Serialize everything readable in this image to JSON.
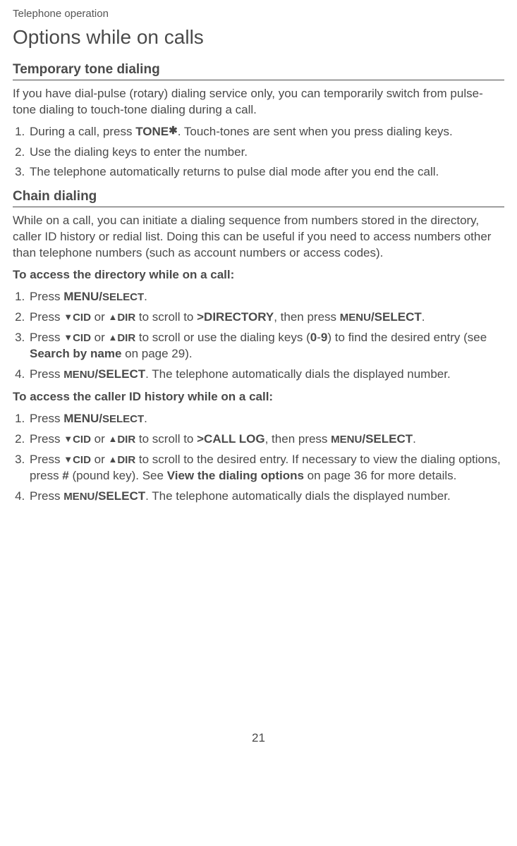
{
  "header": "Telephone operation",
  "title": "Options while on calls",
  "section1": {
    "heading": "Temporary tone dialing",
    "intro": "If you have dial-pulse (rotary) dialing service only, you can temporarily switch from pulse-tone dialing to touch-tone dialing during a call.",
    "step1_a": "During a call, press ",
    "step1_tone": "TONE",
    "step1_b": ". Touch-tones are sent when you press dialing keys.",
    "step2": "Use the dialing keys to enter the number.",
    "step3": "The telephone automatically returns to pulse dial mode after you end the call."
  },
  "section2": {
    "heading": "Chain dialing",
    "intro": "While on a call, you can initiate a dialing sequence from numbers stored in the directory, caller ID history or redial list. Doing this can be useful if you need to access numbers other than telephone numbers (such as account numbers or access codes).",
    "sub1_title": "To access the directory while on a call:",
    "sub1_s1_a": "Press ",
    "sub1_s1_b": "MENU/",
    "sub1_s1_c": "SELECT",
    "sub1_s1_d": ".",
    "sub1_s2_a": "Press ",
    "sub1_s2_cid": "CID",
    "sub1_s2_or": " or ",
    "sub1_s2_dir": "DIR",
    "sub1_s2_b": " to scroll to ",
    "sub1_s2_target": ">DIRECTORY",
    "sub1_s2_c": ", then press ",
    "sub1_s2_menu": "MENU",
    "sub1_s2_select": "/SELECT",
    "sub1_s2_d": ".",
    "sub1_s3_a": "Press ",
    "sub1_s3_b": " to scroll or use the dialing keys (",
    "sub1_s3_09a": "0",
    "sub1_s3_dash": "-",
    "sub1_s3_09b": "9",
    "sub1_s3_c": ") to find the desired entry (see ",
    "sub1_s3_ref": "Search by name",
    "sub1_s3_d": " on page 29).",
    "sub1_s4_a": "Press ",
    "sub1_s4_menu": "MENU",
    "sub1_s4_select": "/SELECT",
    "sub1_s4_b": ". The telephone automatically dials the displayed number.",
    "sub2_title": "To access the caller ID history while on a call:",
    "sub2_s2_target": ">CALL LOG",
    "sub2_s3_a": " to scroll to the desired entry. If necessary to view the dialing options, press ",
    "sub2_s3_pound": "#",
    "sub2_s3_b": " (pound key). See ",
    "sub2_s3_ref": "View the dialing options",
    "sub2_s3_c": " on page 36 for more details."
  },
  "page_number": "21"
}
